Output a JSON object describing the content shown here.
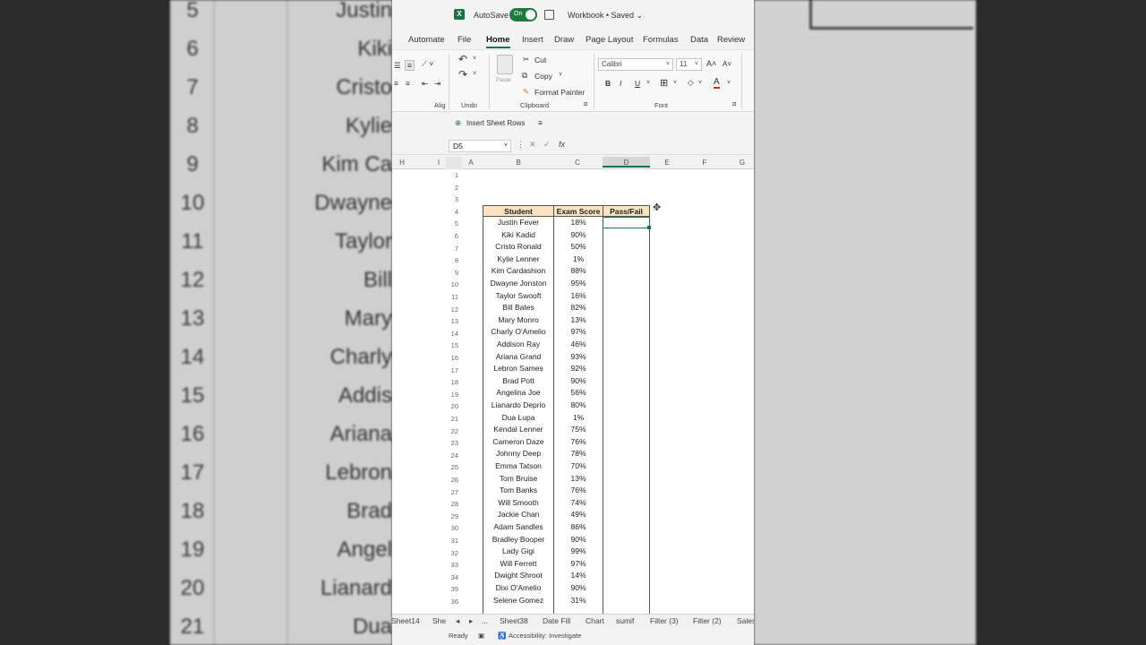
{
  "background": {
    "left_rows": [
      "5",
      "6",
      "7",
      "8",
      "9",
      "10",
      "11",
      "12",
      "13",
      "14",
      "15",
      "16",
      "17",
      "18",
      "19",
      "20",
      "21"
    ],
    "left_names": [
      "Justin",
      "Kiki",
      "Cristo",
      "Kylie",
      "Kim Ca",
      "Dwayne",
      "Taylor",
      "Bill",
      "Mary",
      "Charly",
      "Addis",
      "Ariana",
      "Lebron",
      "Brad",
      "Angel",
      "Lianard",
      "Dua"
    ]
  },
  "titlebar": {
    "autosave_label": "AutoSave",
    "toggle_state": "On",
    "workbook_title": "Workbook • Saved ⌄"
  },
  "tabs": [
    "Automate",
    "File",
    "Home",
    "Insert",
    "Draw",
    "Page Layout",
    "Formulas",
    "Data",
    "Review"
  ],
  "active_tab": "Home",
  "ribbon": {
    "cut": "Cut",
    "copy": "Copy",
    "format_painter": "Format Painter",
    "paste": "Paste",
    "undo_group": "Undo",
    "clipboard_group": "Clipboard",
    "font_group": "Font",
    "alignment_group": "Alig",
    "font_name": "Calibri",
    "font_size": "11",
    "bold": "B",
    "italic": "I",
    "underline": "U",
    "insert_sheet_rows": "Insert Sheet Rows"
  },
  "formula_bar": {
    "name_box": "D5",
    "fx": "fx",
    "value": ""
  },
  "column_headers": [
    "H",
    "I",
    "A",
    "B",
    "C",
    "D",
    "E",
    "F",
    "G"
  ],
  "table": {
    "headers": [
      "Student",
      "Exam Score",
      "Pass/Fail"
    ],
    "rows": [
      [
        "Justin Fever",
        "18%"
      ],
      [
        "Kiki Kadid",
        "90%"
      ],
      [
        "Cristo Ronald",
        "50%"
      ],
      [
        "Kylie Lenner",
        "1%"
      ],
      [
        "Kim Cardashion",
        "88%"
      ],
      [
        "Dwayne Jonston",
        "95%"
      ],
      [
        "Taylor Swooft",
        "16%"
      ],
      [
        "Bill Bates",
        "82%"
      ],
      [
        "Mary Monro",
        "13%"
      ],
      [
        "Charly O'Amelio",
        "97%"
      ],
      [
        "Addison Ray",
        "46%"
      ],
      [
        "Ariana Grand",
        "93%"
      ],
      [
        "Lebron Sames",
        "92%"
      ],
      [
        "Brad Pott",
        "90%"
      ],
      [
        "Angelina Joe",
        "56%"
      ],
      [
        "Lianardo Deprio",
        "80%"
      ],
      [
        "Dua Lupa",
        "1%"
      ],
      [
        "Kendal Lenner",
        "75%"
      ],
      [
        "Cameron Daze",
        "76%"
      ],
      [
        "Johnny Deep",
        "78%"
      ],
      [
        "Emma Tatson",
        "70%"
      ],
      [
        "Tom Bruise",
        "13%"
      ],
      [
        "Tom Banks",
        "76%"
      ],
      [
        "Will Smooth",
        "74%"
      ],
      [
        "Jackie Chan",
        "49%"
      ],
      [
        "Adam Sandles",
        "86%"
      ],
      [
        "Bradley Booper",
        "90%"
      ],
      [
        "Lady Gigi",
        "99%"
      ],
      [
        "Will Ferrett",
        "97%"
      ],
      [
        "Dwight Shroot",
        "14%"
      ],
      [
        "Dixi O'Amelio",
        "90%"
      ],
      [
        "Selene Gomez",
        "31%"
      ]
    ]
  },
  "row_numbers": [
    "1",
    "2",
    "3",
    "4",
    "5",
    "6",
    "7",
    "8",
    "9",
    "10",
    "11",
    "12",
    "13",
    "14",
    "15",
    "16",
    "17",
    "18",
    "19",
    "20",
    "21",
    "22",
    "23",
    "24",
    "25",
    "26",
    "27",
    "28",
    "29",
    "30",
    "31",
    "32",
    "33",
    "34",
    "35",
    "36"
  ],
  "sheet_tabs": [
    "Sheet14",
    "She",
    "...",
    "Sheet38",
    "Date Fill",
    "Chart",
    "sumif",
    "Filter (3)",
    "Filter (2)",
    "Sales"
  ],
  "status": {
    "ready": "Ready",
    "accessibility": "Accessibility: Investigate"
  }
}
